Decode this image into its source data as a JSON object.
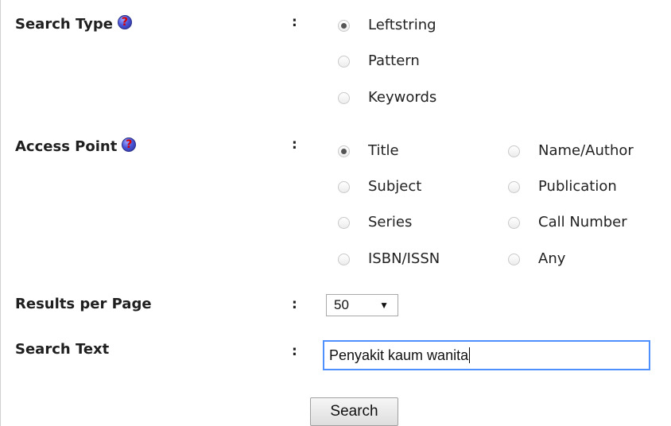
{
  "search_type": {
    "label": "Search Type",
    "help_icon": "question-mark-icon",
    "colon": ":",
    "selected": "Leftstring",
    "options": [
      "Leftstring",
      "Pattern",
      "Keywords"
    ]
  },
  "access_point": {
    "label": "Access Point",
    "help_icon": "question-mark-icon",
    "colon": ":",
    "selected": "Title",
    "options": [
      "Title",
      "Name/Author",
      "Subject",
      "Publication",
      "Series",
      "Call Number",
      "ISBN/ISSN",
      "Any"
    ]
  },
  "results_per_page": {
    "label": "Results per Page",
    "colon": ":",
    "value": "50",
    "arrow": "▼"
  },
  "search_text": {
    "label": "Search Text",
    "colon": ":",
    "value": "Penyakit kaum wanita"
  },
  "help_glyph": "?",
  "search_button_label": "Search",
  "colors": {
    "focus_border": "#4d90fe",
    "help_icon": "#4a56d8",
    "help_mark": "#d80000"
  }
}
